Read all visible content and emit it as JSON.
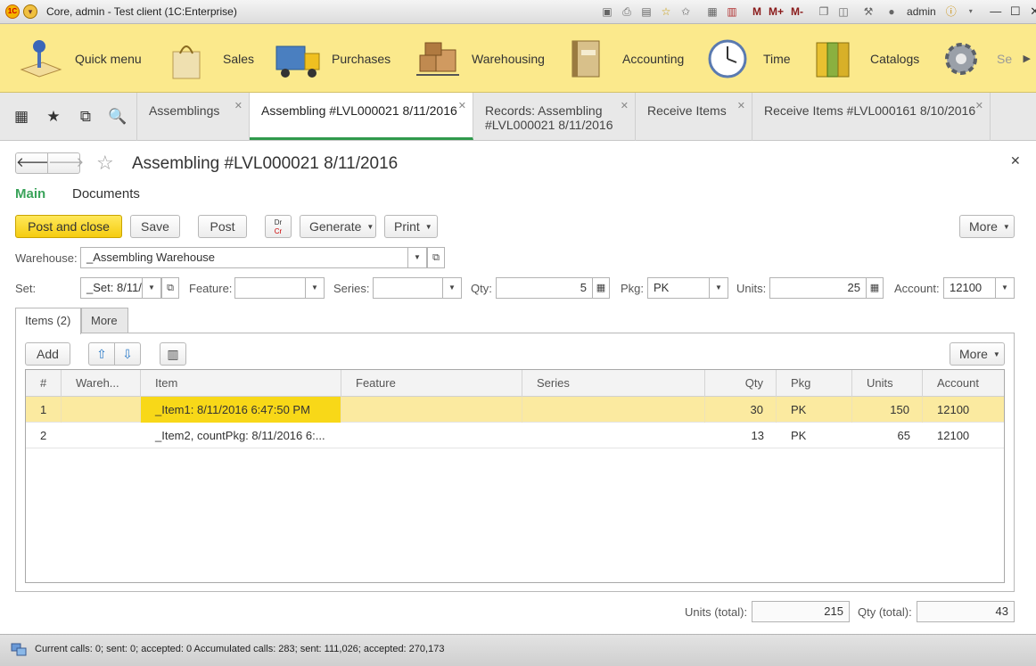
{
  "window": {
    "title": "Core, admin  - Test client (1C:Enterprise)",
    "user": "admin",
    "logo_text": "1C",
    "memory_buttons": [
      "M",
      "M+",
      "M-"
    ]
  },
  "sections": [
    {
      "label": "Quick menu",
      "icon": "quick-menu-icon"
    },
    {
      "label": "Sales",
      "icon": "shopping-bag-icon"
    },
    {
      "label": "Purchases",
      "icon": "truck-icon"
    },
    {
      "label": "Warehousing",
      "icon": "boxes-cart-icon"
    },
    {
      "label": "Accounting",
      "icon": "ledger-book-icon"
    },
    {
      "label": "Time",
      "icon": "clock-icon"
    },
    {
      "label": "Catalogs",
      "icon": "binders-icon"
    },
    {
      "label": "Se",
      "icon": "gear-icon"
    }
  ],
  "open_tabs": [
    {
      "label": "Assemblings"
    },
    {
      "label": "Assembling #LVL000021 8/11/2016"
    },
    {
      "label_line1": "Records: Assembling",
      "label_line2": "#LVL000021 8/11/2016"
    },
    {
      "label": "Receive Items"
    },
    {
      "label": "Receive Items #LVL000161 8/10/2016"
    }
  ],
  "form": {
    "title": "Assembling #LVL000021 8/11/2016",
    "tabs": {
      "main": "Main",
      "documents": "Documents"
    },
    "toolbar": {
      "post_and_close": "Post and close",
      "save": "Save",
      "post": "Post",
      "drcr_top": "Dr",
      "drcr_bottom": "Cr",
      "generate": "Generate",
      "print": "Print",
      "more": "More"
    },
    "warehouse": {
      "label": "Warehouse:",
      "value": "_Assembling Warehouse"
    },
    "set": {
      "label": "Set:",
      "value": "_Set: 8/11/"
    },
    "feature": {
      "label": "Feature:",
      "value": ""
    },
    "series": {
      "label": "Series:",
      "value": ""
    },
    "qty": {
      "label": "Qty:",
      "value": "5"
    },
    "pkg": {
      "label": "Pkg:",
      "value": "PK"
    },
    "units": {
      "label": "Units:",
      "value": "25"
    },
    "account": {
      "label": "Account:",
      "value": "12100"
    }
  },
  "items_panel": {
    "tab_items": "Items (2)",
    "tab_more": "More",
    "add": "Add",
    "more": "More",
    "columns": [
      "#",
      "Wareh...",
      "Item",
      "Feature",
      "Series",
      "Qty",
      "Pkg",
      "Units",
      "Account"
    ],
    "rows": [
      {
        "n": "1",
        "warehouse": "",
        "item": "_Item1: 8/11/2016 6:47:50 PM",
        "feature": "",
        "series": "",
        "qty": "30",
        "pkg": "PK",
        "units": "150",
        "account": "12100"
      },
      {
        "n": "2",
        "warehouse": "",
        "item": "_Item2, countPkg: 8/11/2016 6:...",
        "feature": "",
        "series": "",
        "qty": "13",
        "pkg": "PK",
        "units": "65",
        "account": "12100"
      }
    ]
  },
  "totals": {
    "units_label": "Units (total):",
    "units_value": "215",
    "qty_label": "Qty (total):",
    "qty_value": "43"
  },
  "status": {
    "text": "Current calls: 0; sent: 0; accepted: 0   Accumulated calls: 283; sent: 111,026; accepted: 270,173"
  },
  "colors": {
    "sections_bg": "#fbe98c",
    "primary_button": "#f5cc10",
    "active_tab_accent": "#2f9a4c",
    "selected_row": "#fbeaa0",
    "current_cell": "#f8d818"
  }
}
